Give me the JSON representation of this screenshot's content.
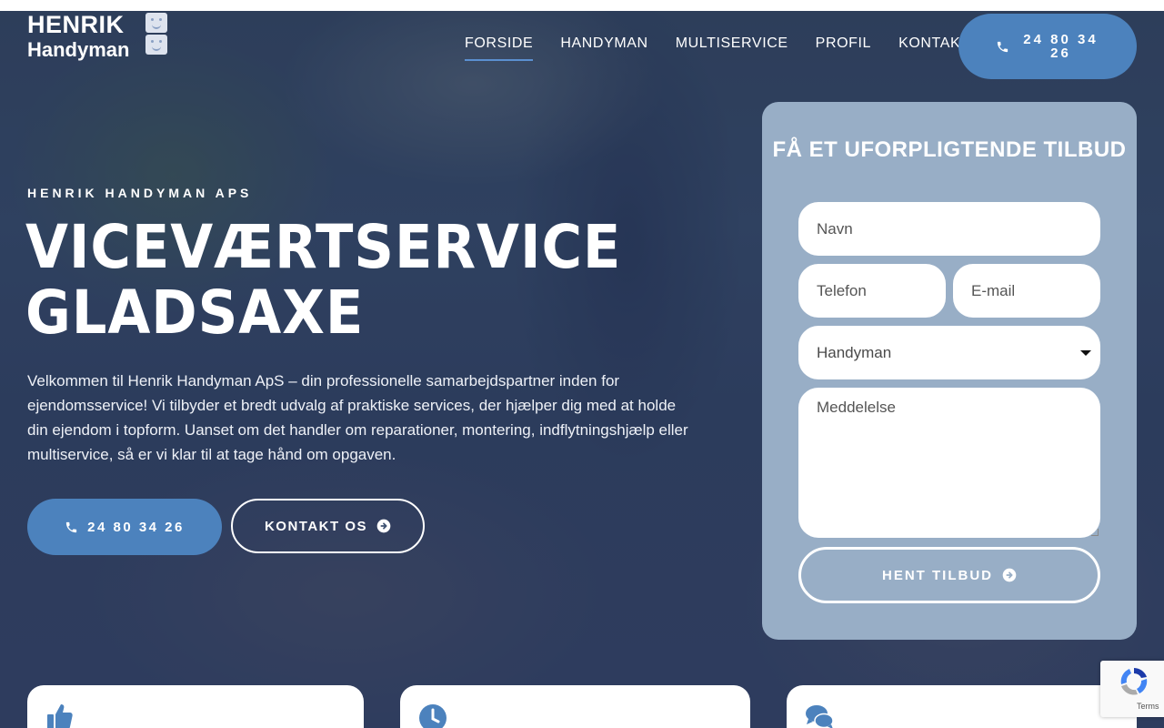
{
  "brand": {
    "line1": "HENRIK",
    "line2": "Handyman"
  },
  "nav": {
    "items": [
      {
        "label": "FORSIDE",
        "active": true
      },
      {
        "label": "HANDYMAN"
      },
      {
        "label": "MULTISERVICE"
      },
      {
        "label": "PROFIL"
      },
      {
        "label": "KONTAKT"
      }
    ],
    "phone_label": "24 80 34 26"
  },
  "hero": {
    "eyebrow": "HENRIK HANDYMAN APS",
    "title_line1": "VICEVÆRTSERVICE",
    "title_line2": "GLADSAXE",
    "intro": "Velkommen til Henrik Handyman ApS – din professionelle samarbejdspartner inden for ejendomsservice! Vi tilbyder et bredt udvalg af praktiske services, der hjælper dig med at holde din ejendom i topform. Uanset om det handler om reparationer, montering, indflytningshjælp eller multiservice, så er vi klar til at tage hånd om opgaven.",
    "phone_button": "24 80 34 26",
    "contact_button": "KONTAKT OS"
  },
  "form": {
    "title": "FÅ ET UFORPLIGTENDE TILBUD",
    "name_placeholder": "Navn",
    "phone_placeholder": "Telefon",
    "email_placeholder": "E-mail",
    "service_selected": "Handyman",
    "message_placeholder": "Meddelelse",
    "submit_label": "HENT TILBUD"
  },
  "cards": [
    {
      "icon": "thumbs-up-icon"
    },
    {
      "icon": "clock-icon"
    },
    {
      "icon": "comments-icon"
    }
  ],
  "recaptcha": {
    "terms": "Terms"
  },
  "colors": {
    "accent": "#4c82bd",
    "form_bg": "#98aec6",
    "nav_active": "#5b8fd0"
  }
}
